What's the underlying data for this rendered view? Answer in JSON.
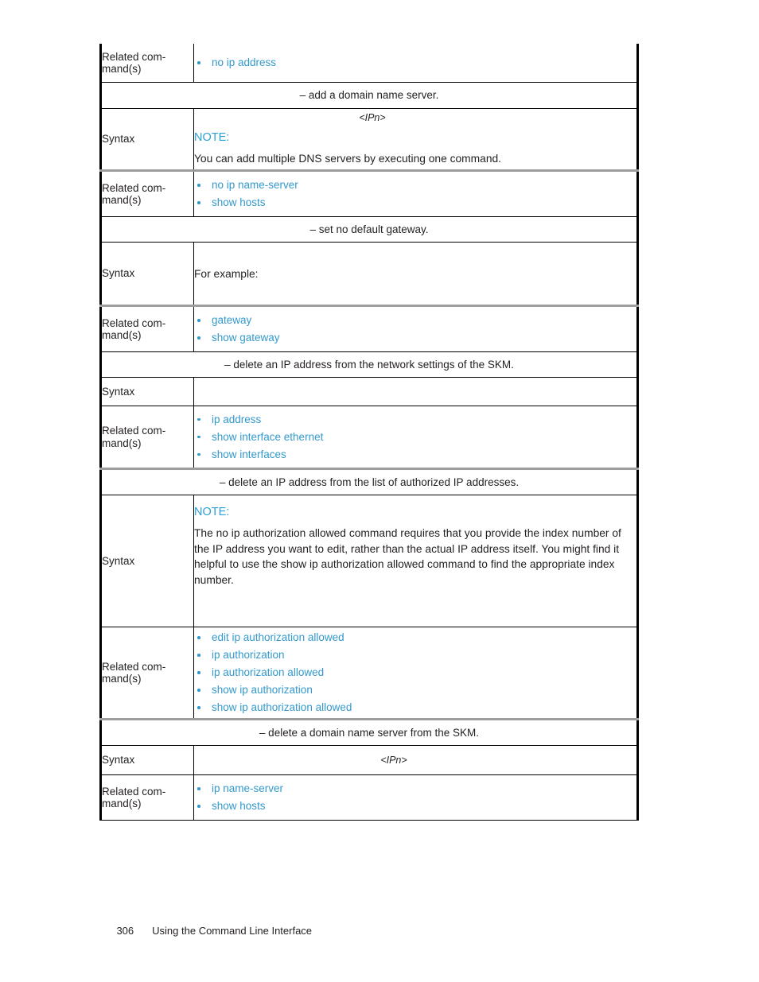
{
  "document": {
    "footer": {
      "page_number": "306",
      "chapter_title": "Using the Command Line Interface"
    }
  },
  "labels": {
    "related_commands": "Related com-\nmand(s)",
    "syntax": "Syntax"
  },
  "note_label": "NOTE:",
  "colors": {
    "link": "#3399cc",
    "note": "#2ba0d6",
    "text": "#231f20",
    "rule_black": "#000000",
    "rule_gray": "#9d9d9d"
  },
  "table": {
    "rows": [
      {
        "kind": "related",
        "label": "Related com-\nmand(s)",
        "commands": [
          "no ip address"
        ]
      },
      {
        "kind": "section",
        "text": "– add a domain name server."
      },
      {
        "kind": "syntax_note",
        "label": "Syntax",
        "syntax_placeholder": "<IPn>",
        "note_label": "NOTE:",
        "note_text": "You can add multiple DNS servers by executing one command."
      },
      {
        "kind": "related",
        "label": "Related com-\nmand(s)",
        "commands": [
          "no ip name-server",
          "show hosts"
        ]
      },
      {
        "kind": "section",
        "text": "– set no default gateway."
      },
      {
        "kind": "syntax_text",
        "label": "Syntax",
        "text": "For example:"
      },
      {
        "kind": "related",
        "label": "Related com-\nmand(s)",
        "commands": [
          "gateway",
          "show gateway"
        ]
      },
      {
        "kind": "section",
        "text": "– delete an IP address from the network settings of the SKM."
      },
      {
        "kind": "syntax_empty",
        "label": "Syntax",
        "text": ""
      },
      {
        "kind": "related",
        "label": "Related com-\nmand(s)",
        "commands": [
          "ip address",
          "show interface ethernet",
          "show interfaces"
        ]
      },
      {
        "kind": "section",
        "text": "– delete an IP address from the list of authorized IP addresses."
      },
      {
        "kind": "syntax_note_long",
        "label": "Syntax",
        "note_label": "NOTE:",
        "note_text": "The no ip authorization allowed command requires that you provide the index number of the IP address you want to edit, rather than the actual IP address itself. You might find it helpful to use the show ip authorization allowed command to find the appropriate index number."
      },
      {
        "kind": "related",
        "label": "Related com-\nmand(s)",
        "commands": [
          "edit ip authorization allowed",
          "ip authorization",
          "ip authorization allowed",
          "show ip authorization",
          "show ip authorization allowed"
        ]
      },
      {
        "kind": "section",
        "text": "– delete a domain name server from the SKM."
      },
      {
        "kind": "syntax_ipn",
        "label": "Syntax",
        "syntax_placeholder": "<IPn>"
      },
      {
        "kind": "related",
        "label": "Related com-\nmand(s)",
        "commands": [
          "ip name-server",
          "show hosts"
        ]
      }
    ]
  }
}
